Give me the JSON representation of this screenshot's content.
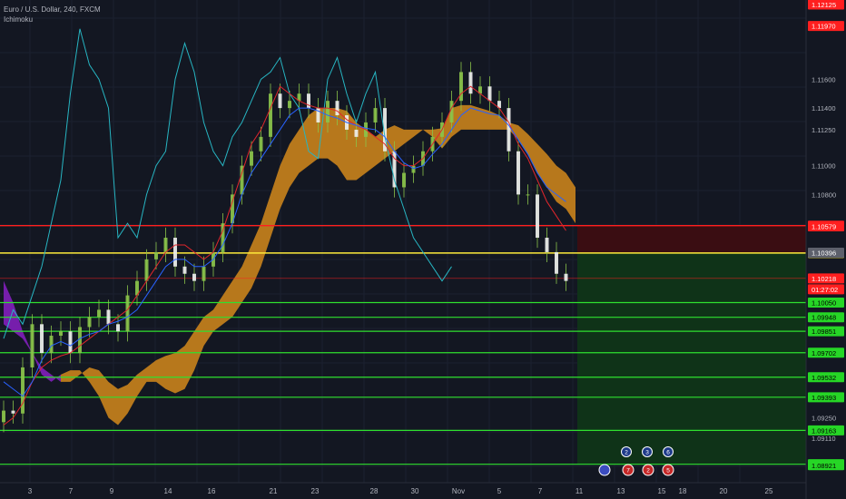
{
  "legend": {
    "symbol_line": "Euro / U.S. Dollar, 240, FXCM",
    "indicator_line": "Ichimoku"
  },
  "colors": {
    "background": "#131722",
    "kumo_bull": "#c07d1c",
    "kumo_bear": "#7b1fb4",
    "tenkan": "#2962ff",
    "kijun": "#e0262c",
    "chikou": "#27b5c2",
    "candle": "#8bc34a",
    "green_line": "#2fe02f",
    "yellow_line": "#ffeb3b",
    "red_line": "#ff1f1f",
    "stop_zone": "#3a0d12",
    "target_zone": "#0f3318",
    "grid": "#1b2130"
  },
  "chart_data": {
    "type": "candlestick",
    "title": "Euro / U.S. Dollar, 240, FXCM",
    "indicator": "Ichimoku",
    "y_range": [
      1.088,
      1.1215
    ],
    "x_ticks": [
      "3",
      "7",
      "9",
      "14",
      "16",
      "21",
      "23",
      "28",
      "30",
      "Nov",
      "5",
      "7",
      "11",
      "13",
      "15",
      "18",
      "20",
      "25"
    ],
    "y_ticks": [
      "1.12125",
      "1.11970",
      "1.11600",
      "1.11400",
      "1.11250",
      "1.11000",
      "1.10800",
      "1.10584",
      "1.10579",
      "1.10394",
      "1.10396",
      "1.10218",
      "01:27:02",
      "1.10050",
      "1.09948",
      "1.09851",
      "1.09702",
      "1.09532",
      "1.09393",
      "1.09250",
      "1.09163",
      "1.09110",
      "1.08928",
      "1.08921"
    ],
    "price_levels": {
      "red": 1.10584,
      "yellow": 1.10394,
      "thin_red": 1.10218,
      "greens": [
        1.1005,
        1.09948,
        1.09851,
        1.09702,
        1.09532,
        1.09393,
        1.09163,
        1.08928
      ]
    },
    "highlighted_labels": [
      {
        "text": "1.12125",
        "kind": "red"
      },
      {
        "text": "1.11970",
        "kind": "red"
      },
      {
        "text": "1.10584",
        "kind": "red"
      },
      {
        "text": "1.10579",
        "kind": "red"
      },
      {
        "text": "1.10394",
        "kind": "yellow"
      },
      {
        "text": "1.10396",
        "kind": "gray"
      },
      {
        "text": "1.10218",
        "kind": "red"
      },
      {
        "text": "01:27:02",
        "kind": "red"
      },
      {
        "text": "1.10050",
        "kind": "green"
      },
      {
        "text": "1.09948",
        "kind": "green"
      },
      {
        "text": "1.09851",
        "kind": "green"
      },
      {
        "text": "1.09702",
        "kind": "green"
      },
      {
        "text": "1.09532",
        "kind": "green"
      },
      {
        "text": "1.09393",
        "kind": "green"
      },
      {
        "text": "1.09163",
        "kind": "green"
      },
      {
        "text": "1.08928",
        "kind": "green"
      },
      {
        "text": "1.08921",
        "kind": "green"
      }
    ],
    "position_zones": {
      "stop_top": 1.10584,
      "stop_bottom": 1.10394,
      "target_top": 1.10394,
      "target_bottom": 1.08928
    },
    "series": [
      {
        "name": "close",
        "values": [
          1.093,
          1.0928,
          1.096,
          1.099,
          1.097,
          1.0982,
          1.0985,
          1.097,
          1.0988,
          1.0995,
          1.1,
          1.099,
          1.0985,
          1.101,
          1.102,
          1.1035,
          1.104,
          1.105,
          1.103,
          1.1025,
          1.102,
          1.103,
          1.104,
          1.106,
          1.108,
          1.11,
          1.111,
          1.112,
          1.115,
          1.114,
          1.1145,
          1.115,
          1.114,
          1.113,
          1.1145,
          1.1135,
          1.1125,
          1.112,
          1.113,
          1.114,
          1.111,
          1.1085,
          1.1095,
          1.11,
          1.111,
          1.112,
          1.113,
          1.1145,
          1.1165,
          1.115,
          1.1155,
          1.1145,
          1.114,
          1.111,
          1.108,
          1.108,
          1.105,
          1.104,
          1.1025,
          1.102
        ]
      },
      {
        "name": "tenkan",
        "values": [
          1.095,
          1.0945,
          1.094,
          1.095,
          1.0965,
          1.0975,
          1.0978,
          1.0975,
          1.098,
          1.0983,
          1.0985,
          1.099,
          1.0992,
          1.0995,
          1.1,
          1.101,
          1.102,
          1.103,
          1.1035,
          1.1035,
          1.103,
          1.103,
          1.1035,
          1.1045,
          1.106,
          1.108,
          1.1095,
          1.1105,
          1.1115,
          1.1125,
          1.1135,
          1.114,
          1.114,
          1.1138,
          1.1135,
          1.1133,
          1.113,
          1.1128,
          1.1126,
          1.1125,
          1.112,
          1.111,
          1.1102,
          1.1098,
          1.11,
          1.1108,
          1.1115,
          1.1125,
          1.1135,
          1.114,
          1.1138,
          1.1136,
          1.1135,
          1.1128,
          1.1118,
          1.1108,
          1.1095,
          1.1085,
          1.108,
          1.1075
        ]
      },
      {
        "name": "kijun",
        "values": [
          1.092,
          1.0925,
          1.0935,
          1.095,
          1.096,
          1.0965,
          1.0968,
          1.097,
          1.0975,
          1.098,
          1.0985,
          1.099,
          1.0995,
          1.1,
          1.101,
          1.102,
          1.103,
          1.104,
          1.1045,
          1.1045,
          1.104,
          1.1035,
          1.104,
          1.1055,
          1.1075,
          1.1095,
          1.1115,
          1.1125,
          1.114,
          1.1155,
          1.115,
          1.1145,
          1.1142,
          1.114,
          1.114,
          1.1138,
          1.1132,
          1.1128,
          1.1125,
          1.112,
          1.1115,
          1.1105,
          1.11,
          1.11,
          1.1105,
          1.1115,
          1.1125,
          1.114,
          1.115,
          1.1155,
          1.115,
          1.1145,
          1.114,
          1.113,
          1.1115,
          1.1105,
          1.109,
          1.1075,
          1.1065,
          1.1055
        ]
      },
      {
        "name": "chikou",
        "values": [
          1.098,
          1.1,
          1.099,
          1.101,
          1.103,
          1.106,
          1.109,
          1.115,
          1.1195,
          1.117,
          1.116,
          1.114,
          1.105,
          1.106,
          1.105,
          1.108,
          1.11,
          1.111,
          1.116,
          1.1185,
          1.1165,
          1.113,
          1.111,
          1.11,
          1.112,
          1.113,
          1.1145,
          1.116,
          1.1165,
          1.1175,
          1.115,
          1.114,
          1.111,
          1.1105,
          1.116,
          1.1175,
          1.115,
          1.113,
          1.115,
          1.1165,
          1.112,
          1.109,
          1.107,
          1.105,
          1.104,
          1.103,
          1.102,
          1.103
        ]
      },
      {
        "name": "senkou_a",
        "values": [
          1.099,
          1.0985,
          1.098,
          1.097,
          1.096,
          1.0955,
          1.095,
          1.095,
          1.0955,
          1.096,
          1.0958,
          1.095,
          1.0945,
          1.0948,
          1.0955,
          1.096,
          1.0965,
          1.0968,
          1.097,
          1.0975,
          1.0985,
          1.0995,
          1.1,
          1.101,
          1.102,
          1.103,
          1.1045,
          1.106,
          1.108,
          1.11,
          1.1115,
          1.1125,
          1.1135,
          1.114,
          1.114,
          1.114,
          1.1138,
          1.113,
          1.1125,
          1.112,
          1.1125,
          1.1128,
          1.1125,
          1.1125,
          1.1125,
          1.1125,
          1.1126,
          1.114,
          1.1142,
          1.1142,
          1.114,
          1.1138,
          1.1135,
          1.113,
          1.1128,
          1.1122,
          1.1115,
          1.1108,
          1.11,
          1.1095,
          1.1085
        ]
      },
      {
        "name": "senkou_b",
        "values": [
          1.102,
          1.1005,
          1.0985,
          1.097,
          1.0955,
          1.095,
          1.0955,
          1.0958,
          1.0958,
          1.095,
          1.094,
          1.0925,
          1.092,
          1.0928,
          1.094,
          1.095,
          1.095,
          1.0945,
          1.0942,
          1.0945,
          1.0958,
          1.0975,
          1.0985,
          1.099,
          1.0995,
          1.1005,
          1.1015,
          1.103,
          1.105,
          1.107,
          1.1085,
          1.1095,
          1.11,
          1.1105,
          1.1105,
          1.11,
          1.109,
          1.109,
          1.1095,
          1.11,
          1.1105,
          1.111,
          1.1115,
          1.112,
          1.1125,
          1.112,
          1.1112,
          1.112,
          1.1125,
          1.1125,
          1.1125,
          1.1125,
          1.1125,
          1.1125,
          1.1118,
          1.1108,
          1.1095,
          1.1085,
          1.1075,
          1.107,
          1.106
        ]
      }
    ],
    "event_badges": {
      "top_row": [
        "2",
        "3",
        "6"
      ],
      "bottom_row": [
        "",
        "7",
        "2",
        "5"
      ]
    }
  }
}
